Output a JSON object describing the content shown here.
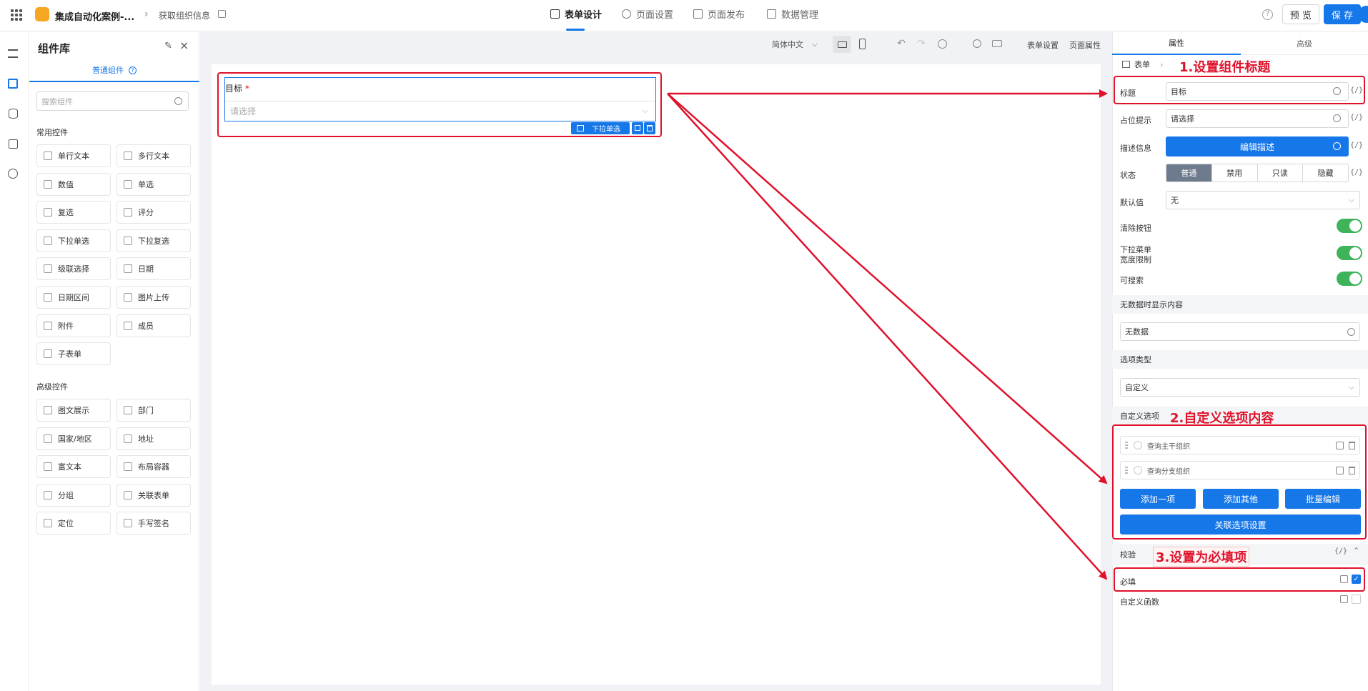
{
  "header": {
    "app_title": "集成自动化案例-...",
    "page_name": "获取组织信息",
    "tabs": [
      "表单设计",
      "页面设置",
      "页面发布",
      "数据管理"
    ],
    "preview": "预 览",
    "save": "保 存"
  },
  "toolbar": {
    "language": "简体中文",
    "form_settings": "表单设置",
    "page_props": "页面属性"
  },
  "library": {
    "title": "组件库",
    "tab": "普通组件",
    "search_placeholder": "搜索组件",
    "group_common": "常用控件",
    "common": [
      "单行文本",
      "多行文本",
      "数值",
      "单选",
      "复选",
      "评分",
      "下拉单选",
      "下拉复选",
      "级联选择",
      "日期",
      "日期区间",
      "图片上传",
      "附件",
      "成员",
      "子表单"
    ],
    "group_advanced": "高级控件",
    "advanced": [
      "图文展示",
      "部门",
      "国家/地区",
      "地址",
      "富文本",
      "布局容器",
      "分组",
      "关联表单",
      "定位",
      "手写签名"
    ]
  },
  "canvas": {
    "field_label": "目标",
    "required_mark": "*",
    "placeholder": "请选择",
    "component_tag": "下拉单选"
  },
  "props": {
    "tab_props": "属性",
    "tab_advanced": "高级",
    "breadcrumb": "表单",
    "title_label": "标题",
    "title_value": "目标",
    "placeholder_label": "占位提示",
    "placeholder_value": "请选择",
    "desc_label": "描述信息",
    "desc_button": "编辑描述",
    "status_label": "状态",
    "status_options": [
      "普通",
      "禁用",
      "只读",
      "隐藏"
    ],
    "default_label": "默认值",
    "default_value": "无",
    "clear_label": "清除按钮",
    "width_label_1": "下拉菜单",
    "width_label_2": "宽度限制",
    "search_label": "可搜索",
    "nodata_section": "无数据时显示内容",
    "nodata_value": "无数据",
    "option_type_section": "选项类型",
    "option_type_value": "自定义",
    "custom_options_section": "自定义选项",
    "options": [
      "查询主干组织",
      "查询分支组织"
    ],
    "add_one": "添加一项",
    "add_other": "添加其他",
    "batch_edit": "批量编辑",
    "link_settings": "关联选项设置",
    "validate_section": "校验",
    "required_label": "必填",
    "custom_func_label": "自定义函数",
    "code_glyph": "{/}"
  },
  "annotations": {
    "a1": "1.设置组件标题",
    "a2": "2.自定义选项内容",
    "a3": "3.设置为必填项"
  },
  "colors": {
    "primary": "#1677e8",
    "annotation": "#e0112b",
    "toggle_on": "#3eb35a"
  }
}
